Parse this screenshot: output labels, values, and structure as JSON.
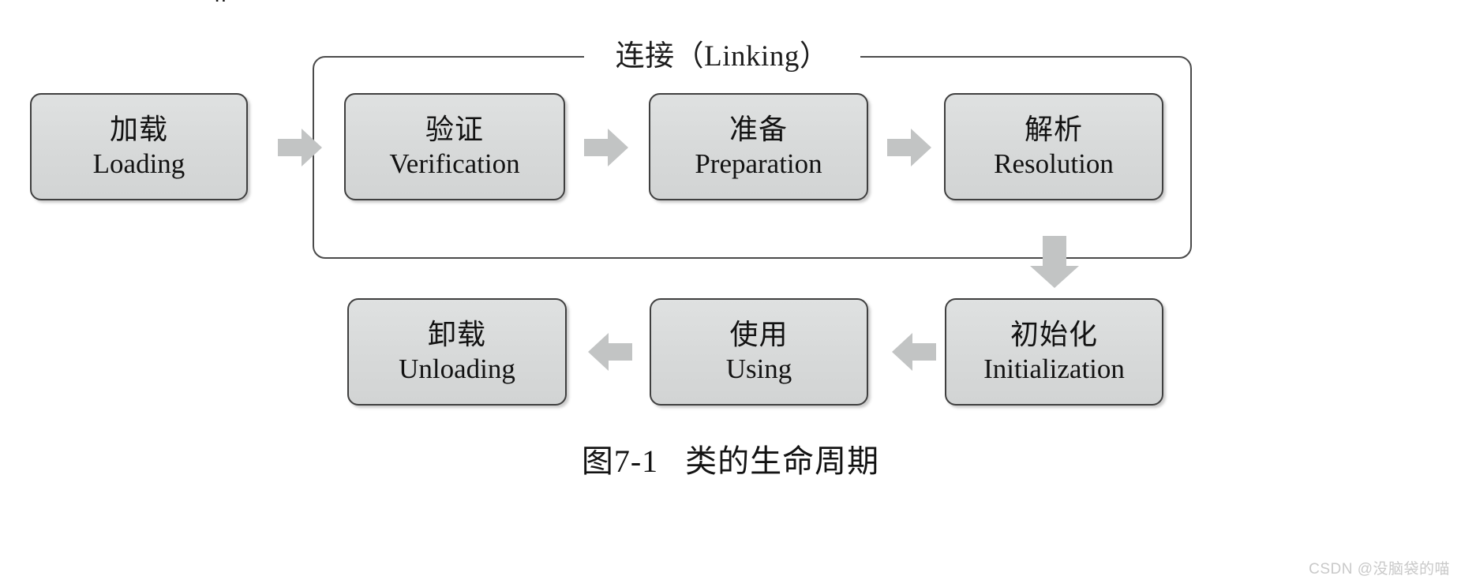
{
  "figure": {
    "top_fragment": "g",
    "group": {
      "label": "连接（Linking）",
      "name": "Linking"
    },
    "caption": {
      "number": "图7-1",
      "text": "类的生命周期"
    },
    "watermark": "CSDN @没脑袋的喵",
    "colors": {
      "box_fill": "#d9dbdb",
      "box_border": "#3f3f3f",
      "arrow_fill": "#c2c4c4",
      "group_border": "#4a4a4a",
      "text": "#121212",
      "watermark": "#c9c9c9",
      "background": "#ffffff"
    },
    "boxes": [
      {
        "id": "loading",
        "cn": "加载",
        "en": "Loading"
      },
      {
        "id": "verification",
        "cn": "验证",
        "en": "Verification"
      },
      {
        "id": "preparation",
        "cn": "准备",
        "en": "Preparation"
      },
      {
        "id": "resolution",
        "cn": "解析",
        "en": "Resolution"
      },
      {
        "id": "initialization",
        "cn": "初始化",
        "en": "Initialization"
      },
      {
        "id": "using",
        "cn": "使用",
        "en": "Using"
      },
      {
        "id": "unloading",
        "cn": "卸载",
        "en": "Unloading"
      }
    ],
    "arrows": [
      {
        "id": "loading-to-verification",
        "direction": "right"
      },
      {
        "id": "verification-to-preparation",
        "direction": "right"
      },
      {
        "id": "preparation-to-resolution",
        "direction": "right"
      },
      {
        "id": "resolution-to-initialization",
        "direction": "down"
      },
      {
        "id": "initialization-to-using",
        "direction": "left"
      },
      {
        "id": "using-to-unloading",
        "direction": "left"
      }
    ]
  }
}
